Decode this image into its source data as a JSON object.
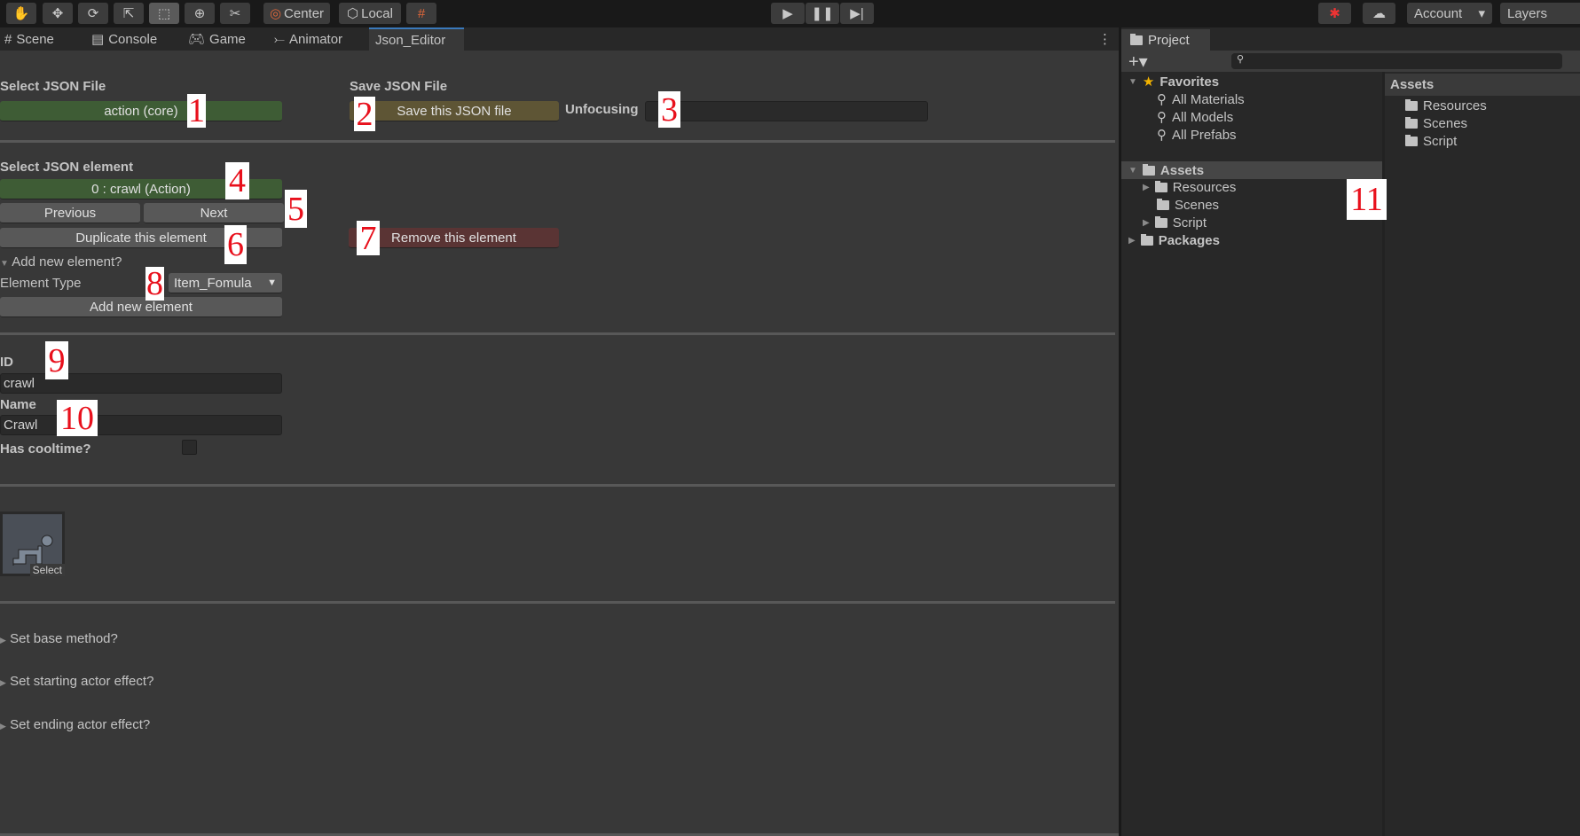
{
  "toolbar": {
    "tools": [
      "hand-tool",
      "move-tool",
      "rotate-tool",
      "scale-tool",
      "rect-tool",
      "transform-tool",
      "custom-tools"
    ],
    "center_label": "Center",
    "local_label": "Local",
    "account_label": "Account",
    "layers_label": "Layers"
  },
  "tabs": [
    {
      "label": "Scene"
    },
    {
      "label": "Console"
    },
    {
      "label": "Game"
    },
    {
      "label": "Animator"
    },
    {
      "label": "Json_Editor"
    }
  ],
  "editor": {
    "select_file_label": "Select JSON File",
    "file_button": "action (core)",
    "save_file_label": "Save JSON File",
    "save_button": "Save this JSON file",
    "unfocusing_label": "Unfocusing",
    "unfocusing_value": "",
    "select_element_label": "Select JSON element",
    "element_button": "0 : crawl (Action)",
    "previous": "Previous",
    "next": "Next",
    "duplicate": "Duplicate this element",
    "remove": "Remove this element",
    "add_new_foldout": "Add new element?",
    "element_type_label": "Element Type",
    "element_type_value": "Item_Fomula",
    "add_new_button": "Add new element",
    "id_label": "ID",
    "id_value": "crawl",
    "name_label": "Name",
    "name_value": "Crawl",
    "cooltime_label": "Has cooltime?",
    "cooltime_checked": false,
    "icon_select": "Select",
    "foldouts": [
      "Set base method?",
      "Set starting actor effect?",
      "Set ending actor effect?"
    ]
  },
  "annotations": [
    "1",
    "2",
    "3",
    "4",
    "5",
    "6",
    "7",
    "8",
    "9",
    "10",
    "11"
  ],
  "project": {
    "tab": "Project",
    "favorites": "Favorites",
    "favorite_items": [
      "All Materials",
      "All Models",
      "All Prefabs"
    ],
    "assets": "Assets",
    "asset_children": [
      "Resources",
      "Scenes",
      "Script"
    ],
    "packages": "Packages",
    "right_header": "Assets",
    "right_items": [
      "Resources",
      "Scenes",
      "Script"
    ]
  },
  "colors": {
    "accent": "#3a79bb",
    "green_button": "#3e5c35",
    "yellow_button": "#5e5535",
    "red_button": "#5a3434",
    "star": "#f4b400"
  }
}
